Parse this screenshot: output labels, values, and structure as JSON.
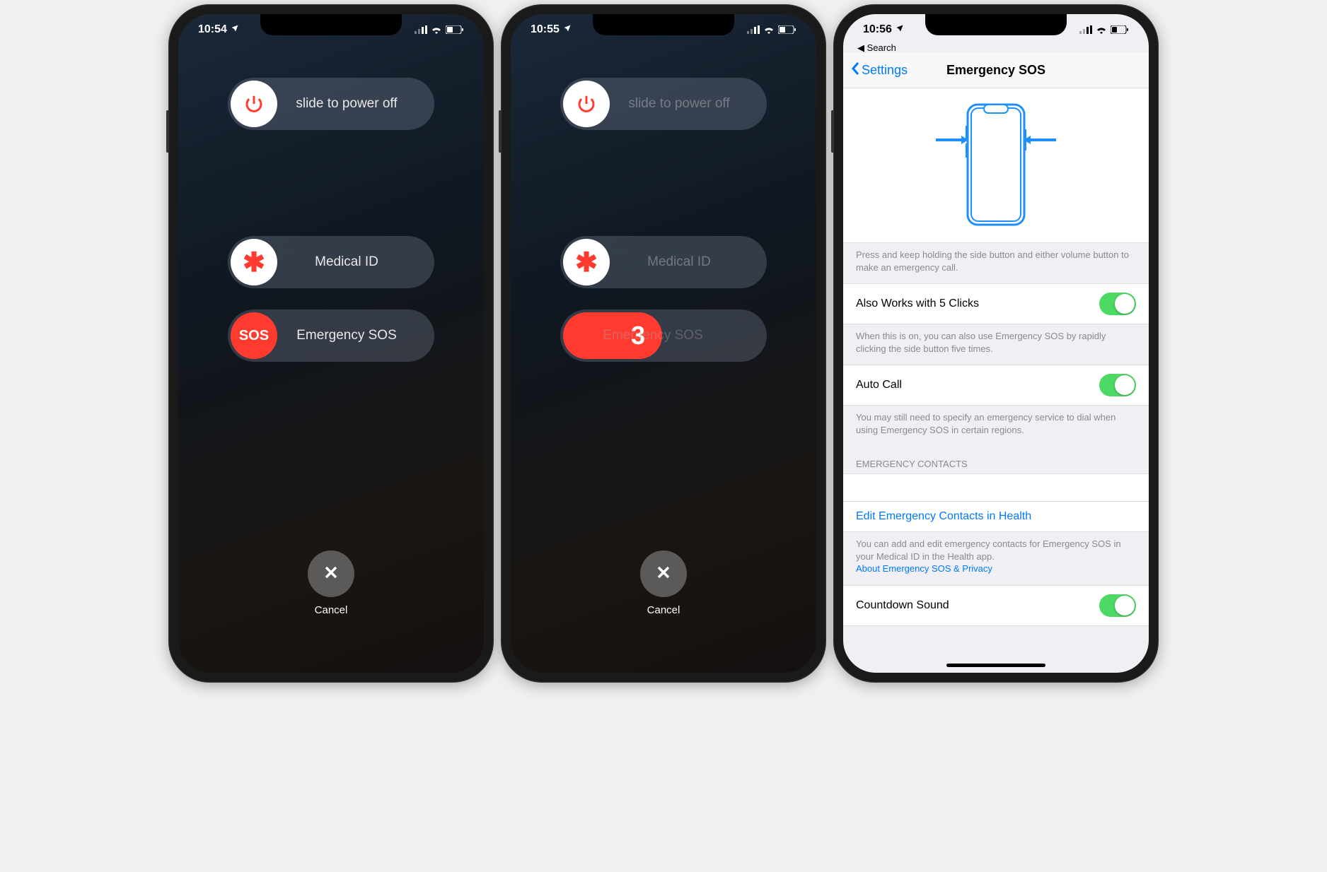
{
  "screen1": {
    "time": "10:54",
    "power_label": "slide to power off",
    "medical_label": "Medical ID",
    "sos_label": "Emergency SOS",
    "sos_knob": "SOS",
    "cancel": "Cancel"
  },
  "screen2": {
    "time": "10:55",
    "power_label": "slide to power off",
    "medical_label": "Medical ID",
    "sos_label_behind": "Emergency SOS",
    "sos_countdown": "3",
    "cancel": "Cancel"
  },
  "screen3": {
    "time": "10:56",
    "breadcrumb": "Search",
    "nav_back": "Settings",
    "nav_title": "Emergency SOS",
    "diagram_footer": "Press and keep holding the side button and either volume button to make an emergency call.",
    "row_5clicks": "Also Works with 5 Clicks",
    "footer_5clicks": "When this is on, you can also use Emergency SOS by rapidly clicking the side button five times.",
    "row_autocall": "Auto Call",
    "footer_autocall": "You may still need to specify an emergency service to dial when using Emergency SOS in certain regions.",
    "section_contacts": "EMERGENCY CONTACTS",
    "row_edit_contacts": "Edit Emergency Contacts in Health",
    "footer_contacts": "You can add and edit emergency contacts for Emergency SOS in your Medical ID in the Health app.",
    "link_privacy": "About Emergency SOS & Privacy",
    "row_countdown_sound": "Countdown Sound"
  },
  "colors": {
    "accent_red": "#ff3b30",
    "accent_blue": "#007aff",
    "toggle_green": "#4cd964"
  }
}
